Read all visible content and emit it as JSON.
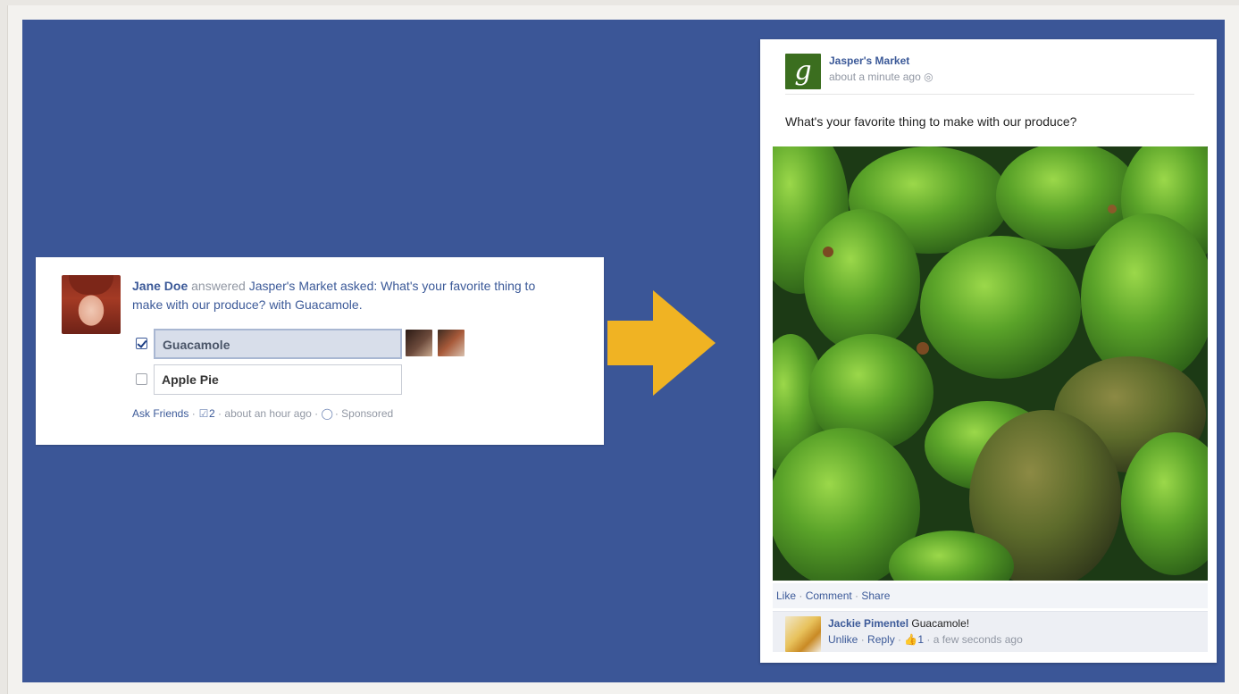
{
  "question_post": {
    "author": "Jane Doe",
    "verb": "answered",
    "page": "Jasper's Market",
    "asked_word": "asked:",
    "question": "What's your favorite thing to make with our produce?",
    "with_word": "with",
    "answer": "Guacamole.",
    "options": [
      {
        "label": "Guacamole",
        "checked": true
      },
      {
        "label": "Apple Pie",
        "checked": false
      }
    ],
    "meta": {
      "ask_friends": "Ask Friends",
      "sep": " · ",
      "vote_count": "2",
      "time": "about an hour ago",
      "sponsored": "Sponsored"
    }
  },
  "arrow": {
    "color": "#f0b323"
  },
  "photo_post": {
    "page_name": "Jasper's Market",
    "logo_letter": "g",
    "time": "about a minute ago",
    "text": "What's your favorite thing to make with our produce?",
    "actions": {
      "like": "Like",
      "comment": "Comment",
      "share": "Share"
    },
    "comment": {
      "author": "Jackie Pimentel",
      "text": "Guacamole!",
      "unlike": "Unlike",
      "reply": "Reply",
      "likes": "1",
      "time": "a few seconds ago"
    }
  },
  "colors": {
    "background": "#3b5697",
    "link": "#3b5998",
    "muted": "#9197a3",
    "avocado": "#5aa329"
  }
}
